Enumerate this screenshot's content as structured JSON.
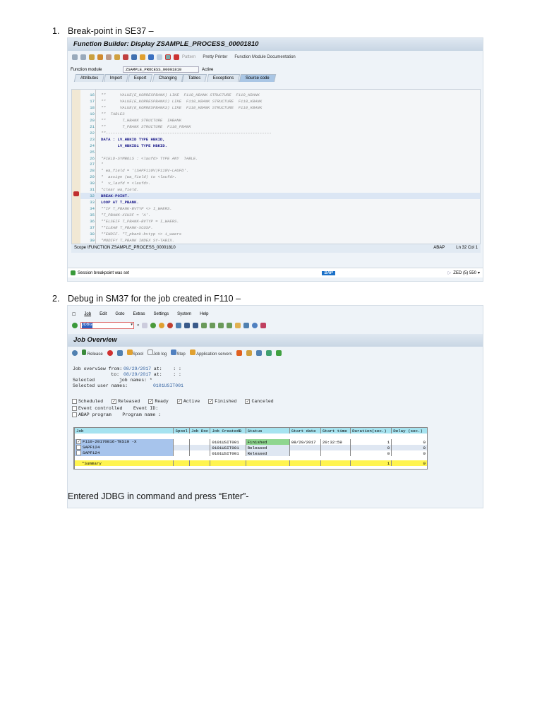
{
  "step1": {
    "number": "1.",
    "text": "Break-point in SE37 –"
  },
  "se37": {
    "title": "Function Builder: Display ZSAMPLE_PROCESS_00001810",
    "toolbar": {
      "pattern": "Pattern",
      "pretty_printer": "Pretty Printer",
      "documentation": "Function Module Documentation"
    },
    "function_module_label": "Function module",
    "function_module_value": "ZSAMPLE_PROCESS_00001810",
    "function_module_status": "Active",
    "tabs": [
      "Attributes",
      "Import",
      "Export",
      "Changing",
      "Tables",
      "Exceptions",
      "Source code"
    ],
    "code_lines": [
      {
        "n": "16",
        "t": "*\"      VALUE(E_KORRESPBANK) LIKE  F110_KBANK STRUCTURE  F110_KBANK",
        "c": "comment"
      },
      {
        "n": "17",
        "t": "*\"      VALUE(E_KORRESPBANK2) LIKE  F110_KBANK STRUCTURE  F110_KBANK",
        "c": "comment"
      },
      {
        "n": "18",
        "t": "*\"      VALUE(E_KORRESPBANK3) LIKE  F110_KBANK STRUCTURE  F110_KBANK",
        "c": "comment"
      },
      {
        "n": "19",
        "t": "*\"  TABLES",
        "c": "comment"
      },
      {
        "n": "20",
        "t": "*\"       T_HBANK STRUCTURE  IHBANK",
        "c": "comment"
      },
      {
        "n": "21",
        "t": "*\"       T_PBANK STRUCTURE  F110_PBANK",
        "c": "comment"
      },
      {
        "n": "22",
        "t": "*\"----------------------------------------------------------------------",
        "c": "comment"
      },
      {
        "n": "23",
        "t": "DATA : LV_HBKID TYPE HBKID,",
        "c": "kw"
      },
      {
        "n": "24",
        "t": "       LV_HBKID1 TYPE HBKID.",
        "c": "kw"
      },
      {
        "n": "25",
        "t": "",
        "c": ""
      },
      {
        "n": "26",
        "t": "*FIELD-SYMBOLS : <laufd> TYPE ANY  TABLE.",
        "c": "comment"
      },
      {
        "n": "27",
        "t": "*",
        "c": "comment"
      },
      {
        "n": "28",
        "t": "* wa_field = '(SAPF110V)F110V-LAUFD'.",
        "c": "comment"
      },
      {
        "n": "29",
        "t": "*  assign (wa_field) to <laufd>.",
        "c": "comment"
      },
      {
        "n": "30",
        "t": "*  v_laufd = <laufd>.",
        "c": "comment"
      },
      {
        "n": "31",
        "t": "*clear wa_field.",
        "c": "comment"
      },
      {
        "n": "32",
        "t": "BREAK-POINT.",
        "c": "kw hl"
      },
      {
        "n": "33",
        "t": "LOOP AT T_PBANK.",
        "c": "kw"
      },
      {
        "n": "34",
        "t": "**IF T_PBANK-BVTYP <> I_WAERS.",
        "c": "comment"
      },
      {
        "n": "35",
        "t": "*T_PBANK-XCUSF = 'A'.",
        "c": "comment"
      },
      {
        "n": "36",
        "t": "**ELSEIF T_PBANK-BVTYP = I_WAERS.",
        "c": "comment"
      },
      {
        "n": "37",
        "t": "**CLEAR T_PBANK-XCUSF.",
        "c": "comment"
      },
      {
        "n": "38",
        "t": "**ENDIF. \"T_pbank-bvtyp <> i_waers",
        "c": "comment"
      },
      {
        "n": "39",
        "t": "*MODIFY T_PBANK INDEX SY-TABIX.",
        "c": "comment"
      }
    ],
    "scope": "Scope \\FUNCTION ZSAMPLE_PROCESS_00001810",
    "lang": "ABAP",
    "position": "Ln 32 Col 1",
    "status_message": "Session breakpoint was set",
    "system": "ZED (5) 550",
    "logo": "SAP"
  },
  "step2": {
    "number": "2.",
    "text": "Debug in SM37 for the job created in F110 –"
  },
  "sm37": {
    "menu": [
      "Job",
      "Edit",
      "Goto",
      "Extras",
      "Settings",
      "System",
      "Help"
    ],
    "command": "JDBG",
    "title": "Job Overview",
    "app_toolbar": [
      "Release",
      "Spool",
      "Job log",
      "Step",
      "Application servers"
    ],
    "info": {
      "from_label": "Job overview from:",
      "from_date": "08/29/2017",
      "at1": "at:",
      "time1": ":  :",
      "to_label": "to:",
      "to_date": "08/29/2017",
      "at2": "at:",
      "time2": ":  :",
      "selected_label": "Selected",
      "job_names_label": "job names:",
      "job_names": "*",
      "user_label": "Selected user names:",
      "user": "0101USIT001"
    },
    "filters": [
      {
        "label": "Scheduled",
        "checked": false
      },
      {
        "label": "Released",
        "checked": true
      },
      {
        "label": "Ready",
        "checked": true
      },
      {
        "label": "Active",
        "checked": true
      },
      {
        "label": "Finished",
        "checked": true
      },
      {
        "label": "Canceled",
        "checked": true
      }
    ],
    "event_label": "Event controlled",
    "event_id_label": "Event ID:",
    "abap_label": "ABAP program",
    "program_label": "Program name :",
    "columns": [
      "Job",
      "Spool",
      "Job Doc",
      "Job CreatedB",
      "Status",
      "Start date",
      "Start time",
      "Duration(sec.)",
      "Delay (sec.)"
    ],
    "rows": [
      {
        "checked": true,
        "job": "F110-20170816-TES10 -X",
        "spool": "",
        "doc": "",
        "created": "0101USIT001",
        "status": "Finished",
        "date": "08/29/2017",
        "time": "20:32:59",
        "duration": "1",
        "delay": "0"
      },
      {
        "checked": false,
        "job": "SAPF124",
        "spool": "",
        "doc": "",
        "created": "0101USIT001",
        "status": "Released",
        "date": "",
        "time": "",
        "duration": "0",
        "delay": "0"
      },
      {
        "checked": false,
        "job": "SAPF124",
        "spool": "",
        "doc": "",
        "created": "0101USIT001",
        "status": "Released",
        "date": "",
        "time": "",
        "duration": "0",
        "delay": "0"
      }
    ],
    "summary": {
      "label": "*Summary",
      "duration": "1",
      "delay": "0"
    }
  },
  "note": "Entered JDBG in command and press “Enter”-"
}
